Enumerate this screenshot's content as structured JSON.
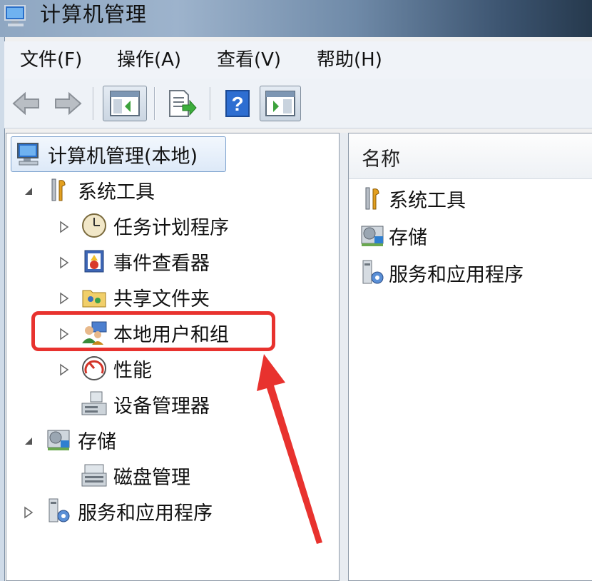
{
  "window": {
    "title": "计算机管理"
  },
  "menu": [
    {
      "label": "文件(F)"
    },
    {
      "label": "操作(A)"
    },
    {
      "label": "查看(V)"
    },
    {
      "label": "帮助(H)"
    }
  ],
  "toolbar": {
    "icons": [
      "back-icon",
      "forward-icon",
      "show-hide-console-tree-icon",
      "export-list-icon",
      "help-icon",
      "show-hide-action-pane-icon"
    ]
  },
  "tree": {
    "root": "计算机管理(本地)",
    "system_tools": "系统工具",
    "task_scheduler": "任务计划程序",
    "event_viewer": "事件查看器",
    "shared_folders": "共享文件夹",
    "local_users_groups": "本地用户和组",
    "performance": "性能",
    "device_manager": "设备管理器",
    "storage": "存储",
    "disk_management": "磁盘管理",
    "services_apps": "服务和应用程序"
  },
  "list": {
    "header": "名称",
    "items": [
      "系统工具",
      "存储",
      "服务和应用程序"
    ]
  },
  "colors": {
    "highlight": "#e8322e",
    "selection_border": "#7da2ce"
  }
}
